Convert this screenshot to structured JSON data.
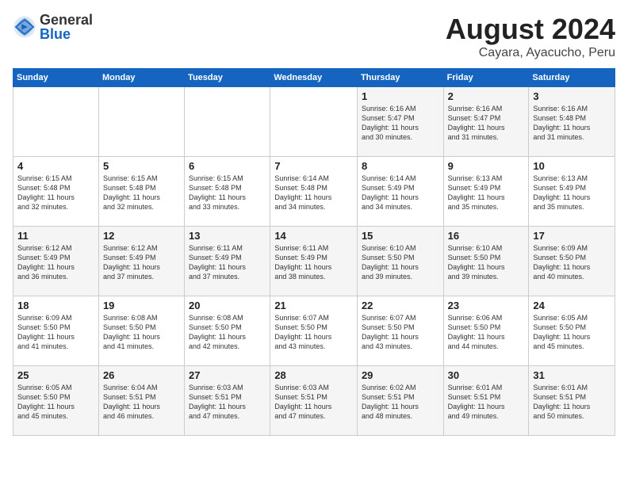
{
  "header": {
    "logo": {
      "general": "General",
      "blue": "Blue"
    },
    "title": "August 2024",
    "subtitle": "Cayara, Ayacucho, Peru"
  },
  "weekdays": [
    "Sunday",
    "Monday",
    "Tuesday",
    "Wednesday",
    "Thursday",
    "Friday",
    "Saturday"
  ],
  "weeks": [
    [
      {
        "day": "",
        "info": ""
      },
      {
        "day": "",
        "info": ""
      },
      {
        "day": "",
        "info": ""
      },
      {
        "day": "",
        "info": ""
      },
      {
        "day": "1",
        "info": "Sunrise: 6:16 AM\nSunset: 5:47 PM\nDaylight: 11 hours\nand 30 minutes."
      },
      {
        "day": "2",
        "info": "Sunrise: 6:16 AM\nSunset: 5:47 PM\nDaylight: 11 hours\nand 31 minutes."
      },
      {
        "day": "3",
        "info": "Sunrise: 6:16 AM\nSunset: 5:48 PM\nDaylight: 11 hours\nand 31 minutes."
      }
    ],
    [
      {
        "day": "4",
        "info": "Sunrise: 6:15 AM\nSunset: 5:48 PM\nDaylight: 11 hours\nand 32 minutes."
      },
      {
        "day": "5",
        "info": "Sunrise: 6:15 AM\nSunset: 5:48 PM\nDaylight: 11 hours\nand 32 minutes."
      },
      {
        "day": "6",
        "info": "Sunrise: 6:15 AM\nSunset: 5:48 PM\nDaylight: 11 hours\nand 33 minutes."
      },
      {
        "day": "7",
        "info": "Sunrise: 6:14 AM\nSunset: 5:48 PM\nDaylight: 11 hours\nand 34 minutes."
      },
      {
        "day": "8",
        "info": "Sunrise: 6:14 AM\nSunset: 5:49 PM\nDaylight: 11 hours\nand 34 minutes."
      },
      {
        "day": "9",
        "info": "Sunrise: 6:13 AM\nSunset: 5:49 PM\nDaylight: 11 hours\nand 35 minutes."
      },
      {
        "day": "10",
        "info": "Sunrise: 6:13 AM\nSunset: 5:49 PM\nDaylight: 11 hours\nand 35 minutes."
      }
    ],
    [
      {
        "day": "11",
        "info": "Sunrise: 6:12 AM\nSunset: 5:49 PM\nDaylight: 11 hours\nand 36 minutes."
      },
      {
        "day": "12",
        "info": "Sunrise: 6:12 AM\nSunset: 5:49 PM\nDaylight: 11 hours\nand 37 minutes."
      },
      {
        "day": "13",
        "info": "Sunrise: 6:11 AM\nSunset: 5:49 PM\nDaylight: 11 hours\nand 37 minutes."
      },
      {
        "day": "14",
        "info": "Sunrise: 6:11 AM\nSunset: 5:49 PM\nDaylight: 11 hours\nand 38 minutes."
      },
      {
        "day": "15",
        "info": "Sunrise: 6:10 AM\nSunset: 5:50 PM\nDaylight: 11 hours\nand 39 minutes."
      },
      {
        "day": "16",
        "info": "Sunrise: 6:10 AM\nSunset: 5:50 PM\nDaylight: 11 hours\nand 39 minutes."
      },
      {
        "day": "17",
        "info": "Sunrise: 6:09 AM\nSunset: 5:50 PM\nDaylight: 11 hours\nand 40 minutes."
      }
    ],
    [
      {
        "day": "18",
        "info": "Sunrise: 6:09 AM\nSunset: 5:50 PM\nDaylight: 11 hours\nand 41 minutes."
      },
      {
        "day": "19",
        "info": "Sunrise: 6:08 AM\nSunset: 5:50 PM\nDaylight: 11 hours\nand 41 minutes."
      },
      {
        "day": "20",
        "info": "Sunrise: 6:08 AM\nSunset: 5:50 PM\nDaylight: 11 hours\nand 42 minutes."
      },
      {
        "day": "21",
        "info": "Sunrise: 6:07 AM\nSunset: 5:50 PM\nDaylight: 11 hours\nand 43 minutes."
      },
      {
        "day": "22",
        "info": "Sunrise: 6:07 AM\nSunset: 5:50 PM\nDaylight: 11 hours\nand 43 minutes."
      },
      {
        "day": "23",
        "info": "Sunrise: 6:06 AM\nSunset: 5:50 PM\nDaylight: 11 hours\nand 44 minutes."
      },
      {
        "day": "24",
        "info": "Sunrise: 6:05 AM\nSunset: 5:50 PM\nDaylight: 11 hours\nand 45 minutes."
      }
    ],
    [
      {
        "day": "25",
        "info": "Sunrise: 6:05 AM\nSunset: 5:50 PM\nDaylight: 11 hours\nand 45 minutes."
      },
      {
        "day": "26",
        "info": "Sunrise: 6:04 AM\nSunset: 5:51 PM\nDaylight: 11 hours\nand 46 minutes."
      },
      {
        "day": "27",
        "info": "Sunrise: 6:03 AM\nSunset: 5:51 PM\nDaylight: 11 hours\nand 47 minutes."
      },
      {
        "day": "28",
        "info": "Sunrise: 6:03 AM\nSunset: 5:51 PM\nDaylight: 11 hours\nand 47 minutes."
      },
      {
        "day": "29",
        "info": "Sunrise: 6:02 AM\nSunset: 5:51 PM\nDaylight: 11 hours\nand 48 minutes."
      },
      {
        "day": "30",
        "info": "Sunrise: 6:01 AM\nSunset: 5:51 PM\nDaylight: 11 hours\nand 49 minutes."
      },
      {
        "day": "31",
        "info": "Sunrise: 6:01 AM\nSunset: 5:51 PM\nDaylight: 11 hours\nand 50 minutes."
      }
    ]
  ]
}
